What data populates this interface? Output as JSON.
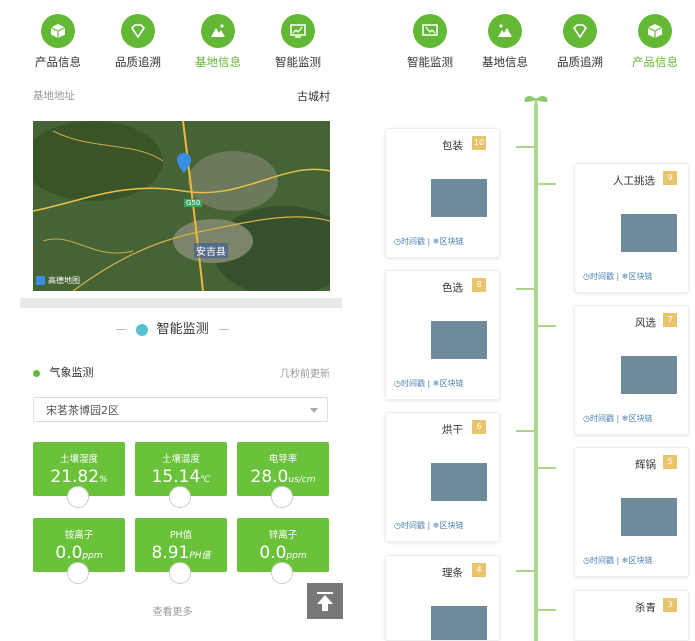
{
  "left_nav": [
    {
      "label": "产品信息",
      "icon": "box-icon",
      "active": false
    },
    {
      "label": "品质追溯",
      "icon": "diamond-icon",
      "active": false
    },
    {
      "label": "基地信息",
      "icon": "mountain-icon",
      "active": true
    },
    {
      "label": "智能监测",
      "icon": "monitor-chart-icon",
      "active": false
    }
  ],
  "address": {
    "label": "基地地址",
    "value": "古城村"
  },
  "map": {
    "city_label": "安吉县",
    "route_badge": "G50",
    "provider": "高德地图"
  },
  "monitor": {
    "section_title": "智能监测",
    "weather_label": "气象监测",
    "updated_text": "几秒前更新",
    "selected_area": "宋茗茶博园2区",
    "cards": [
      {
        "label": "土壤湿度",
        "value": "21.82",
        "unit": "%"
      },
      {
        "label": "土壤温度",
        "value": "15.14",
        "unit": "℃"
      },
      {
        "label": "电导率",
        "value": "28.0",
        "unit": "us/cm"
      },
      {
        "label": "铵离子",
        "value": "0.0",
        "unit": "ppm"
      },
      {
        "label": "PH值",
        "value": "8.91",
        "unit": "PH值"
      },
      {
        "label": "锌离子",
        "value": "0.0",
        "unit": "ppm"
      }
    ],
    "see_more": "查看更多"
  },
  "right_nav": [
    {
      "label": "智能监测",
      "icon": "monitor-chart-icon",
      "active": false
    },
    {
      "label": "基地信息",
      "icon": "mountain-icon",
      "active": false
    },
    {
      "label": "品质追溯",
      "icon": "diamond-icon",
      "active": false
    },
    {
      "label": "产品信息",
      "icon": "box-icon",
      "active": true
    }
  ],
  "timeline": {
    "footer_a": "区块链",
    "footer_b": "时间戳",
    "steps": [
      {
        "num": "10",
        "name": "包装"
      },
      {
        "num": "9",
        "name": "人工挑选"
      },
      {
        "num": "8",
        "name": "色选"
      },
      {
        "num": "7",
        "name": "风选"
      },
      {
        "num": "6",
        "name": "烘干"
      },
      {
        "num": "5",
        "name": "辉锅"
      },
      {
        "num": "4",
        "name": "理条"
      },
      {
        "num": "3",
        "name": "杀青"
      }
    ]
  },
  "colors": {
    "accent": "#63b935",
    "card_green": "#6ac23a",
    "stem": "#aed68a",
    "link": "#4a7fb3"
  }
}
